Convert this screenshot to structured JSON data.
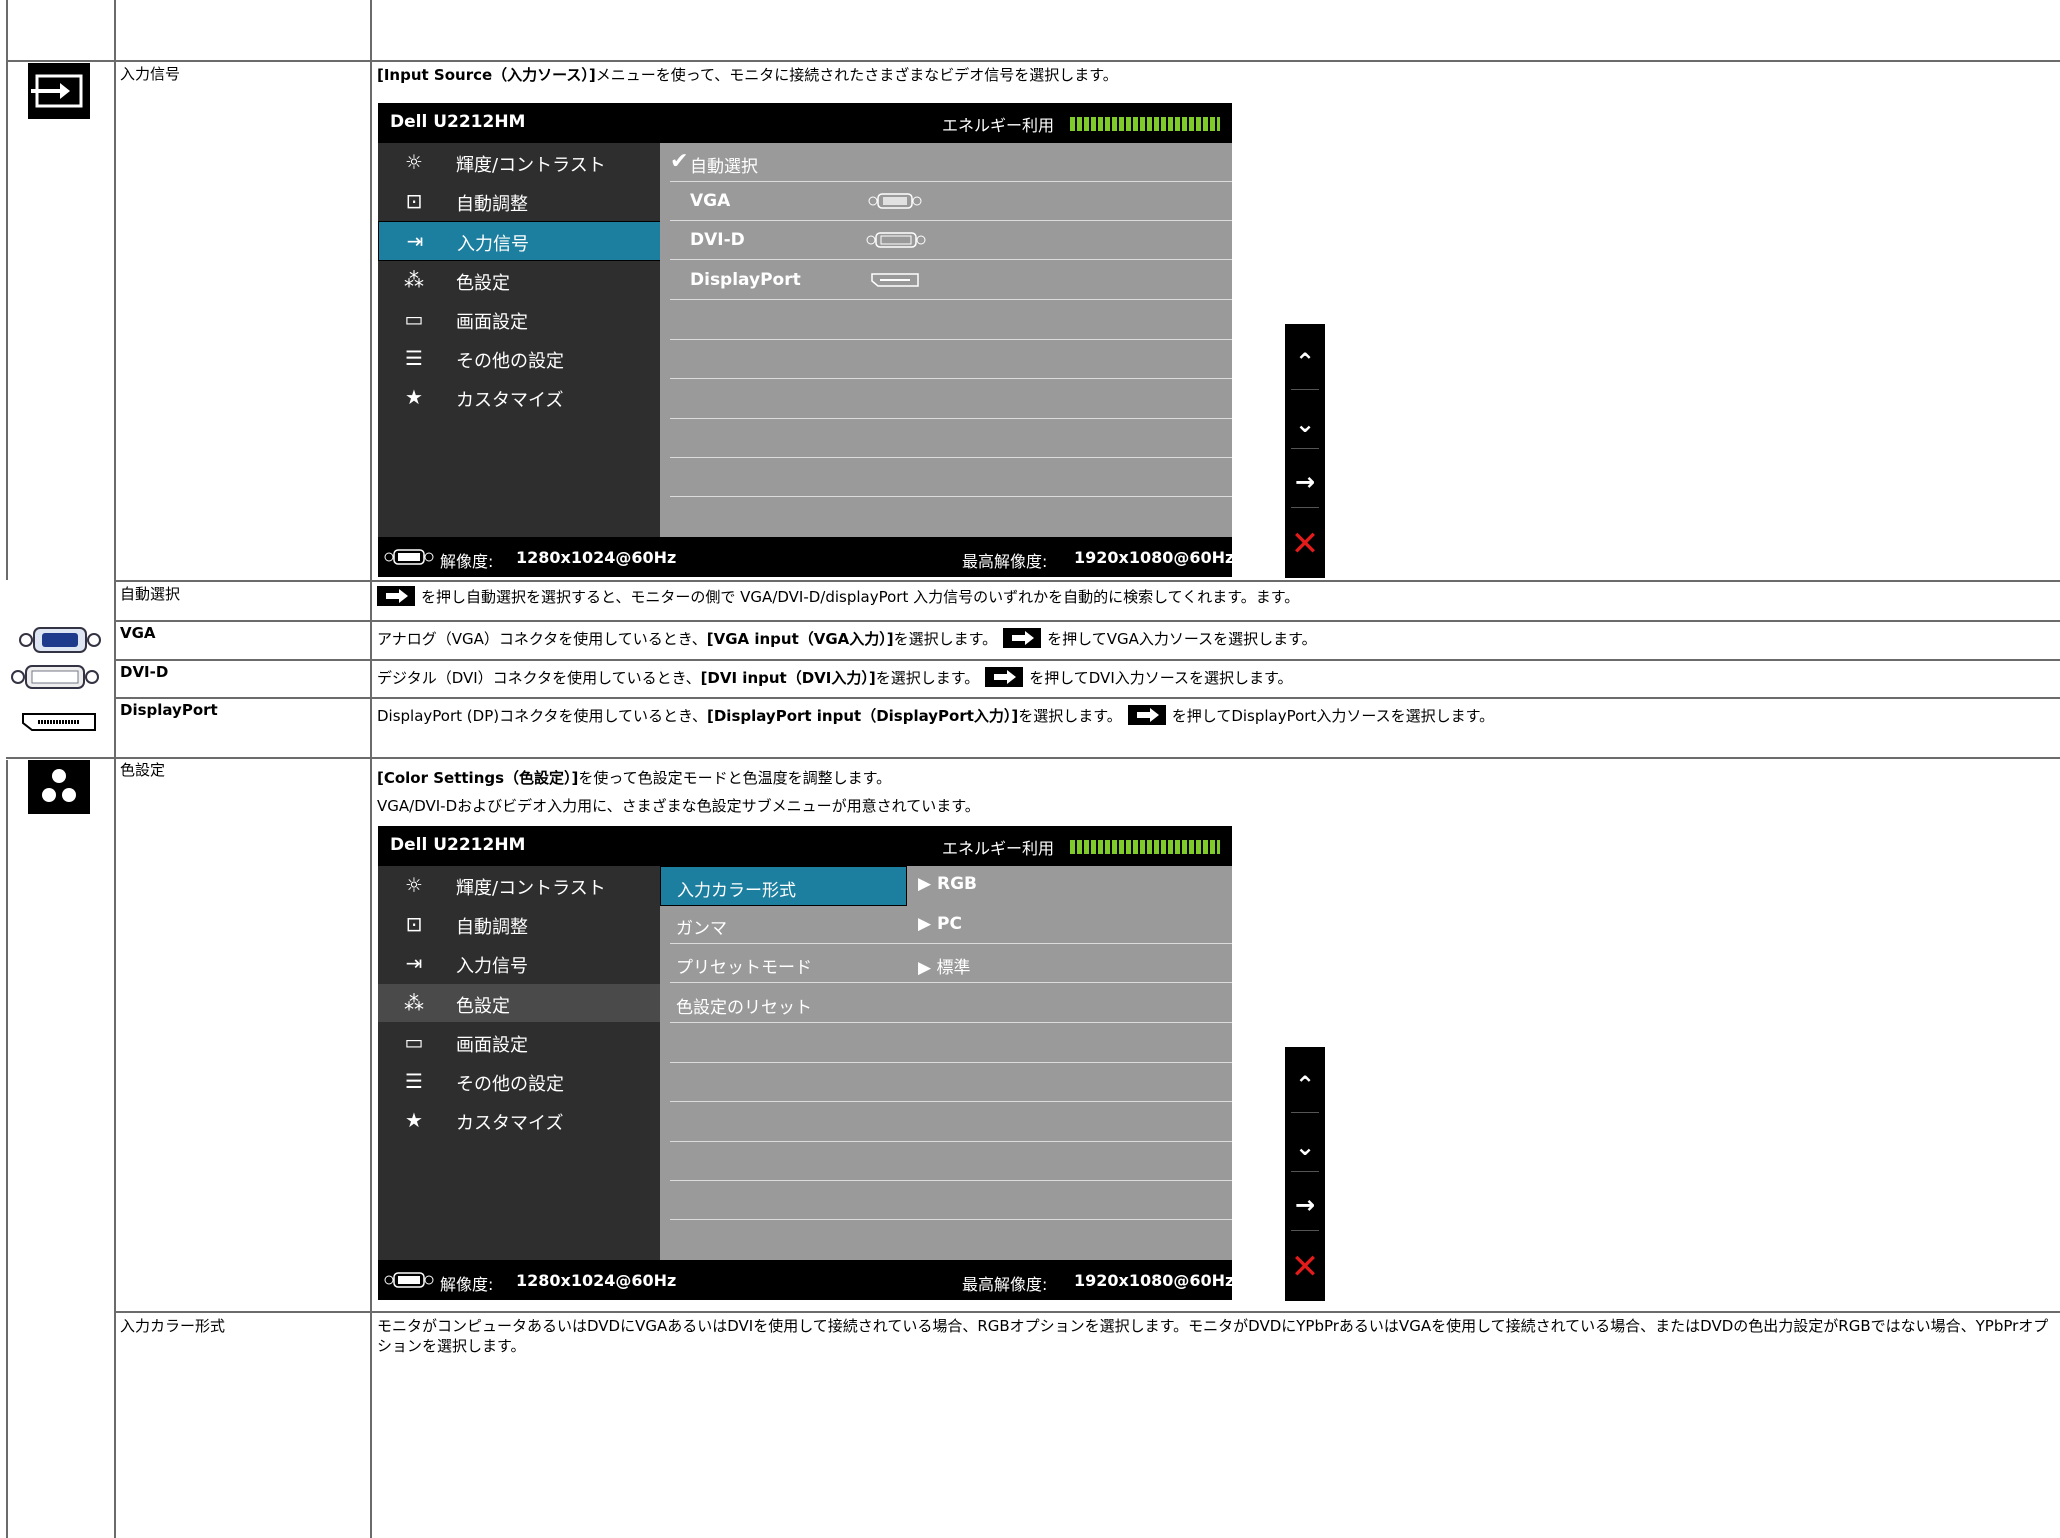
{
  "rows": {
    "input_source": {
      "label": "入力信号",
      "desc_bold": "[Input Source（入力ソース）]",
      "desc_rest": "メニューを使って、モニタに接続されたさまざまなビデオ信号を選択します。"
    },
    "auto_select": {
      "label": "自動選択",
      "desc": "を押し自動選択を選択すると、モニターの側で VGA/DVI-D/displayPort 入力信号のいずれかを自動的に検索してくれます。ます。"
    },
    "vga": {
      "label": "VGA",
      "desc_a": "アナログ（VGA）コネクタを使用しているとき、",
      "desc_bold": "[VGA input（VGA入力）]",
      "desc_b": "を選択します。",
      "desc_c": "を押してVGA入力ソースを選択します。"
    },
    "dvi": {
      "label": "DVI-D",
      "desc_a": "デジタル（DVI）コネクタを使用しているとき、",
      "desc_bold": "[DVI input（DVI入力）]",
      "desc_b": "を選択します。",
      "desc_c": "を押してDVI入力ソースを選択します。"
    },
    "dp": {
      "label": "DisplayPort",
      "desc_a": "DisplayPort (DP)コネクタを使用しているとき、",
      "desc_bold": "[DisplayPort input（DisplayPort入力）]",
      "desc_b": "を選択します。",
      "desc_c": "を押してDisplayPort入力ソースを選択します。"
    },
    "color": {
      "label": "色設定",
      "desc_bold": "[Color Settings（色設定）]",
      "desc_rest": "を使って色設定モードと色温度を調整します。",
      "desc_line2": "VGA/DVI-Dおよびビデオ入力用に、さまざまな色設定サブメニューが用意されています。"
    },
    "input_color": {
      "label": "入力カラー形式",
      "desc": "モニタがコンピュータあるいはDVDにVGAあるいはDVIを使用して接続されている場合、RGBオプションを選択します。モニタがDVDにYPbPrあるいはVGAを使用して接続されている場合、またはDVDの色出力設定がRGBではない場合、YPbPrオプションを選択します。"
    }
  },
  "osd": {
    "model": "Dell U2212HM",
    "energy_label": "エネルギー利用",
    "menu": [
      "輝度/コントラスト",
      "自動調整",
      "入力信号",
      "色設定",
      "画面設定",
      "その他の設定",
      "カスタマイズ"
    ],
    "resolution_label": "解像度:",
    "resolution": "1280x1024@60Hz",
    "max_label": "最高解像度:",
    "max_resolution": "1920x1080@60Hz",
    "input_items": [
      "自動選択",
      "VGA",
      "DVI-D",
      "DisplayPort"
    ],
    "color_items": [
      "入力カラー形式",
      "ガンマ",
      "プリセットモード",
      "色設定のリセット"
    ],
    "color_values": [
      "RGB",
      "PC",
      "標準"
    ]
  },
  "nav": {
    "up": "^",
    "down": "v",
    "enter": "→",
    "exit": "×"
  }
}
